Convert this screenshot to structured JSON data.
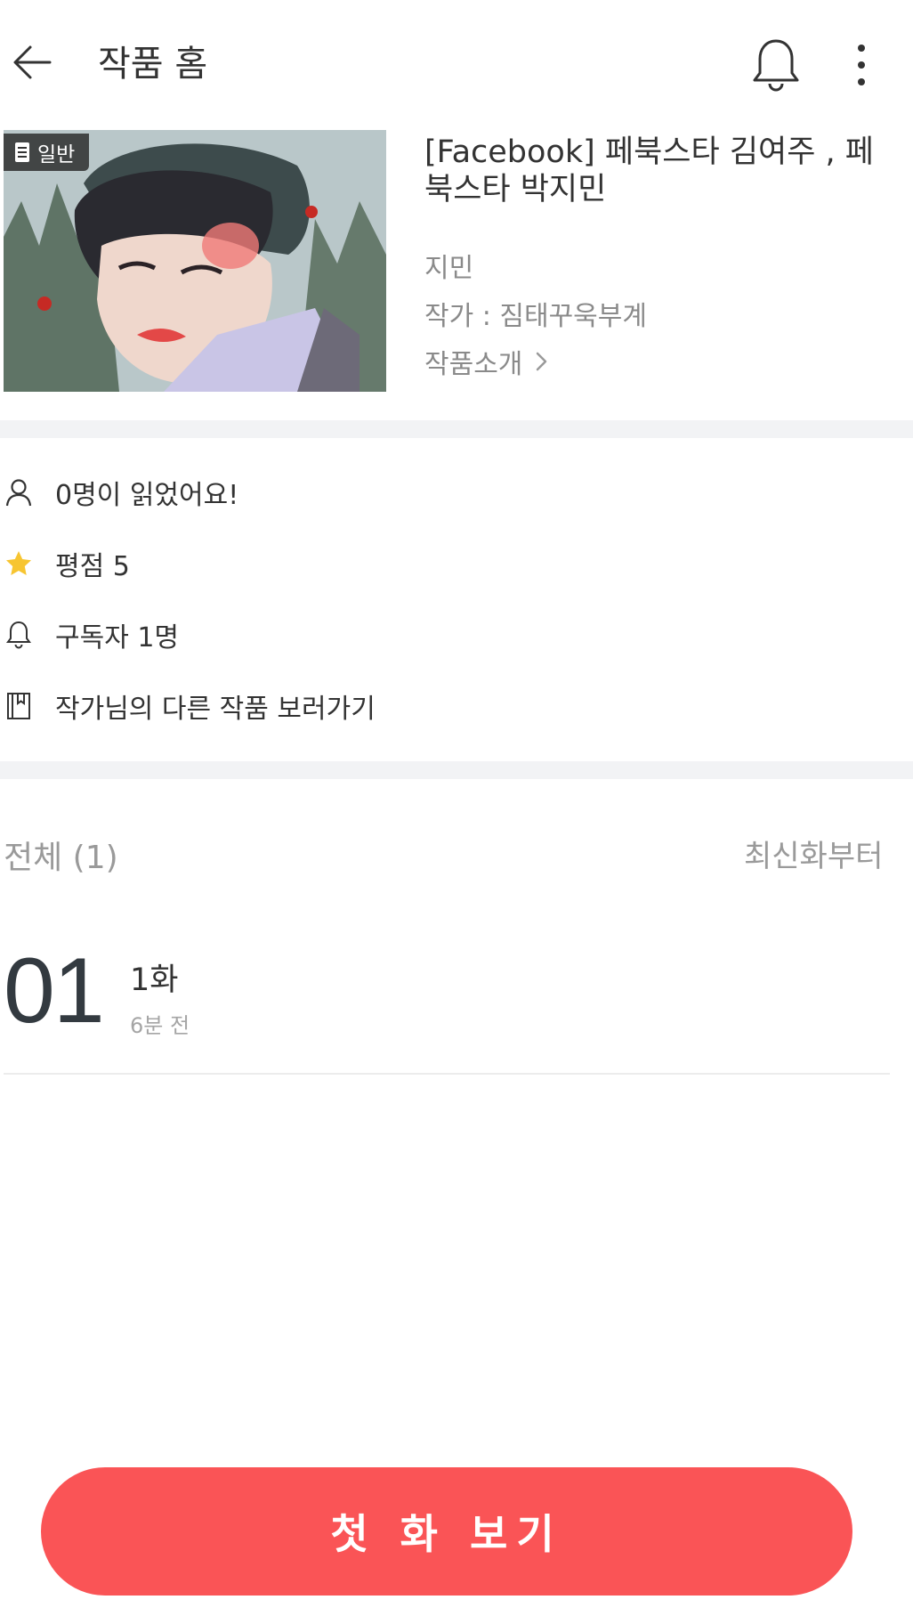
{
  "header": {
    "title": "작품 홈"
  },
  "work": {
    "badge": "일반",
    "title": "[Facebook] 페북스타 김여주 , 페북스타 박지민",
    "genre": "지민",
    "author": "작가 : 짐태꾸욱부계",
    "synopsis_link": "작품소개"
  },
  "stats": {
    "readers": "0명이 읽었어요!",
    "rating": "평점 5",
    "subscribers": "구독자 1명",
    "other_works": "작가님의 다른 작품 보러가기"
  },
  "episodes": {
    "total_label": "전체 (1)",
    "sort_label": "최신화부터",
    "items": [
      {
        "number": "01",
        "title": "1화",
        "time": "6분 전"
      }
    ]
  },
  "cta": {
    "label": "첫 화 보기"
  },
  "colors": {
    "accent": "#fa5456",
    "star": "#f7c531",
    "divider": "#f2f3f5"
  }
}
